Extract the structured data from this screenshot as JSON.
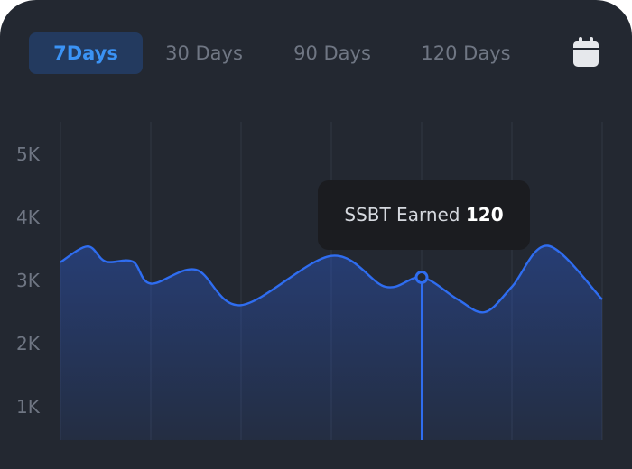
{
  "tabs": [
    {
      "label": "7Days",
      "active": true
    },
    {
      "label": "30 Days",
      "active": false
    },
    {
      "label": "90 Days",
      "active": false
    },
    {
      "label": "120 Days",
      "active": false
    }
  ],
  "calendar_icon": "calendar-icon",
  "tooltip": {
    "label": "SSBT Earned",
    "value": "120"
  },
  "colors": {
    "background": "#232831",
    "accent": "#2f6df0",
    "active_tab_bg": "#233a5f",
    "active_tab_text": "#3b93f5"
  },
  "chart_data": {
    "type": "area",
    "yticks": [
      "5K",
      "4K",
      "3K",
      "2K",
      "1K"
    ],
    "ylim": [
      0,
      5500
    ],
    "xlim": [
      0,
      6
    ],
    "grid": true,
    "series": [
      {
        "points": [
          [
            0.0,
            3290
          ],
          [
            0.3,
            3540
          ],
          [
            0.5,
            3300
          ],
          [
            0.8,
            3300
          ],
          [
            1.0,
            2950
          ],
          [
            1.5,
            3170
          ],
          [
            2.0,
            2610
          ],
          [
            3.0,
            3390
          ],
          [
            3.6,
            2900
          ],
          [
            4.0,
            3050
          ],
          [
            4.4,
            2700
          ],
          [
            4.7,
            2500
          ],
          [
            5.0,
            2900
          ],
          [
            5.4,
            3550
          ],
          [
            6.0,
            2700
          ]
        ]
      }
    ],
    "highlight": {
      "x": 4.0,
      "y": 3050
    }
  }
}
